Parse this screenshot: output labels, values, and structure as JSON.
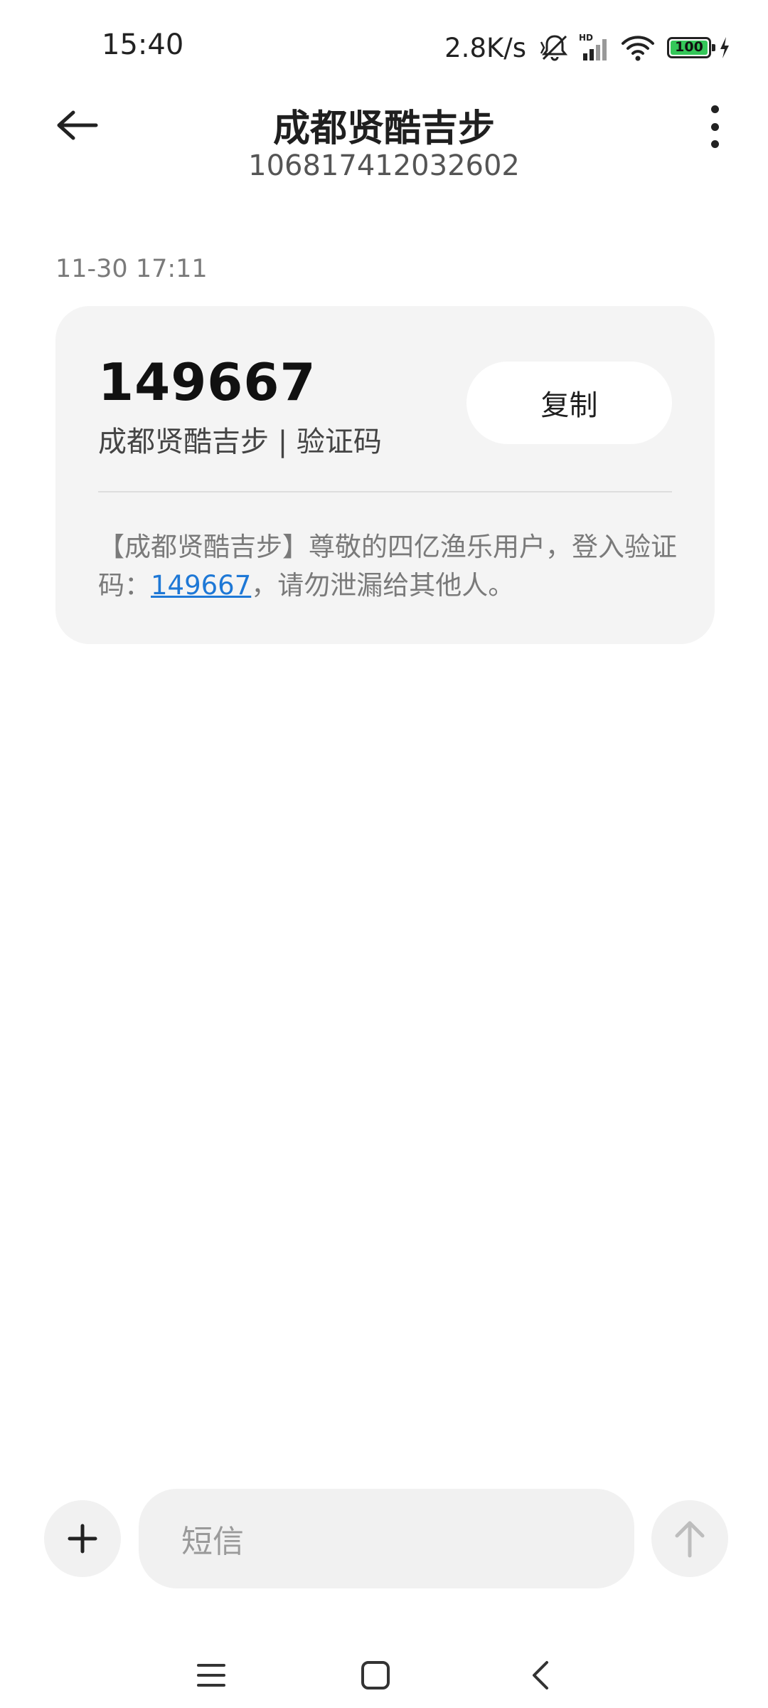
{
  "status_bar": {
    "time": "15:40",
    "net_speed": "2.8K/s",
    "battery_level": "100",
    "icons": [
      "mute-icon",
      "hd-signal-icon",
      "wifi-icon",
      "battery-icon",
      "charging-icon"
    ]
  },
  "header": {
    "title": "成都贤酷吉步",
    "number": "106817412032602"
  },
  "message": {
    "time": "11-30 17:11",
    "code": "149667",
    "source_label": "成都贤酷吉步 | 验证码",
    "copy_label": "复制",
    "body_prefix": "【成都贤酷吉步】尊敬的四亿渔乐用户，登入验证码：",
    "body_code": "149667",
    "body_suffix": "，请勿泄漏给其他人。"
  },
  "composer": {
    "placeholder": "短信"
  },
  "colors": {
    "link": "#1e78d6",
    "card_bg": "#f4f4f4",
    "battery": "#34c759"
  }
}
